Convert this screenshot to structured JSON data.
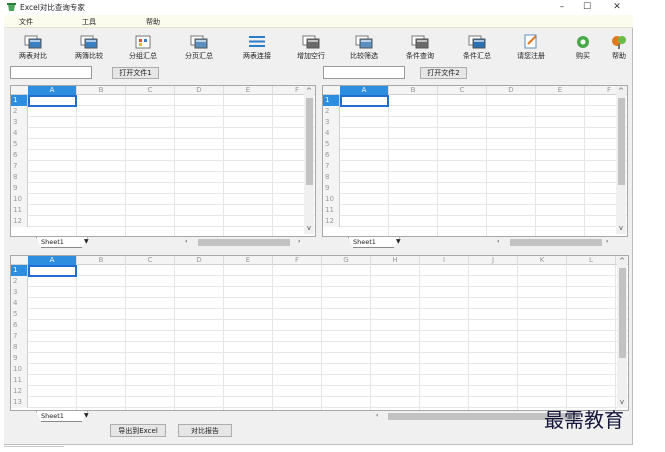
{
  "window": {
    "title": "Excel对比查询专家",
    "min": "–",
    "max": "☐",
    "close": "✕"
  },
  "menu": [
    "文件",
    "工具",
    "帮助"
  ],
  "toolbar": [
    {
      "label": "两表对比",
      "icon": "compare-two-tables-icon",
      "color": "#3a7fc4"
    },
    {
      "label": "两簿比较",
      "icon": "compare-workbooks-icon",
      "color": "#3a7fc4"
    },
    {
      "label": "分组汇总",
      "icon": "group-summary-icon",
      "color": "#d2542a"
    },
    {
      "label": "分页汇总",
      "icon": "page-summary-icon",
      "color": "#5b8fc0"
    },
    {
      "label": "两表连接",
      "icon": "join-tables-icon",
      "color": "#2b7dc4"
    },
    {
      "label": "增加空行",
      "icon": "insert-rows-icon",
      "color": "#6a6a6a"
    },
    {
      "label": "比较筛选",
      "icon": "compare-filter-icon",
      "color": "#5b8fc0"
    },
    {
      "label": "条件查询",
      "icon": "condition-query-icon",
      "color": "#6a6a6a"
    },
    {
      "label": "条件汇总",
      "icon": "condition-summary-icon",
      "color": "#2b6fb0"
    },
    {
      "label": "请您注册",
      "icon": "register-icon",
      "color": "#5b8fc0"
    },
    {
      "label": "购买",
      "icon": "buy-icon",
      "color": "#48a84a"
    },
    {
      "label": "帮助",
      "icon": "help-icon",
      "color": "#e07a1f"
    }
  ],
  "file1": {
    "value": "",
    "open_label": "打开文件1"
  },
  "file2": {
    "value": "",
    "open_label": "打开文件2"
  },
  "grid1": {
    "columns": [
      "A",
      "B",
      "C",
      "D",
      "E",
      "F"
    ],
    "rows": [
      "1",
      "2",
      "3",
      "4",
      "5",
      "6",
      "7",
      "8",
      "9",
      "10",
      "11",
      "12"
    ],
    "sheet": "Sheet1"
  },
  "grid2": {
    "columns": [
      "A",
      "B",
      "C",
      "D",
      "E",
      "F"
    ],
    "rows": [
      "1",
      "2",
      "3",
      "4",
      "5",
      "6",
      "7",
      "8",
      "9",
      "10",
      "11",
      "12"
    ],
    "sheet": "Sheet1"
  },
  "grid3": {
    "columns": [
      "A",
      "B",
      "C",
      "D",
      "E",
      "F",
      "G",
      "H",
      "I",
      "J",
      "K",
      "L"
    ],
    "rows": [
      "1",
      "2",
      "3",
      "4",
      "5",
      "6",
      "7",
      "8",
      "9",
      "10",
      "11",
      "12",
      "13"
    ],
    "sheet": "Sheet1"
  },
  "buttons": {
    "export": "导出到Excel",
    "report": "对比报告"
  },
  "watermark": "最需教育",
  "colors": {
    "selection": "#2d8ee0",
    "menubar": "#fbfbee"
  }
}
